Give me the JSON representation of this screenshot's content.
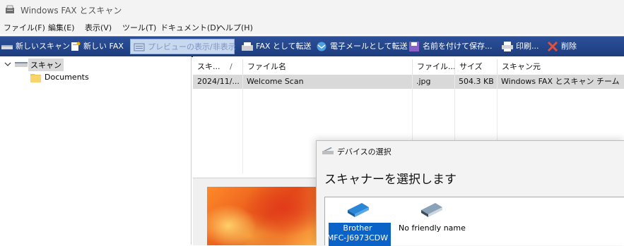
{
  "window": {
    "title": "Windows FAX とスキャン"
  },
  "menu": [
    "ファイル(F)",
    "編集(E)",
    "表示(V)",
    "ツール(T)",
    "ドキュメント(D)",
    "ヘルプ(H)"
  ],
  "toolbar": {
    "new_scan": "新しいスキャン",
    "new_fax": "新しい FAX",
    "toggle_preview": "プレビューの表示/非表示",
    "forward_fax": "FAX として転送",
    "forward_email": "電子メールとして転送",
    "save_as": "名前を付けて保存...",
    "print": "印刷...",
    "delete": "削除"
  },
  "tree": {
    "root": "スキャン",
    "child": "Documents"
  },
  "list": {
    "columns": [
      "スキ...",
      "ファイル名",
      "ファイル...",
      "サイズ",
      "スキャン元"
    ],
    "sort_indicator": "/",
    "rows": [
      {
        "date": "2024/11/...",
        "name": "Welcome Scan",
        "type": ".jpg",
        "size": "504.3 KB",
        "source": "Windows FAX とスキャン チーム"
      }
    ]
  },
  "dialog": {
    "title": "デバイスの選択",
    "heading": "スキャナーを選択します",
    "devices": [
      {
        "line1": "Brother",
        "line2": "MFC-J6973CDW",
        "selected": true
      },
      {
        "line1": "No friendly name",
        "line2": "",
        "selected": false
      }
    ]
  },
  "colors": {
    "toolbar": "#1e3d7e",
    "selection": "#0c63c7",
    "row_highlight": "#d9d9d9"
  }
}
